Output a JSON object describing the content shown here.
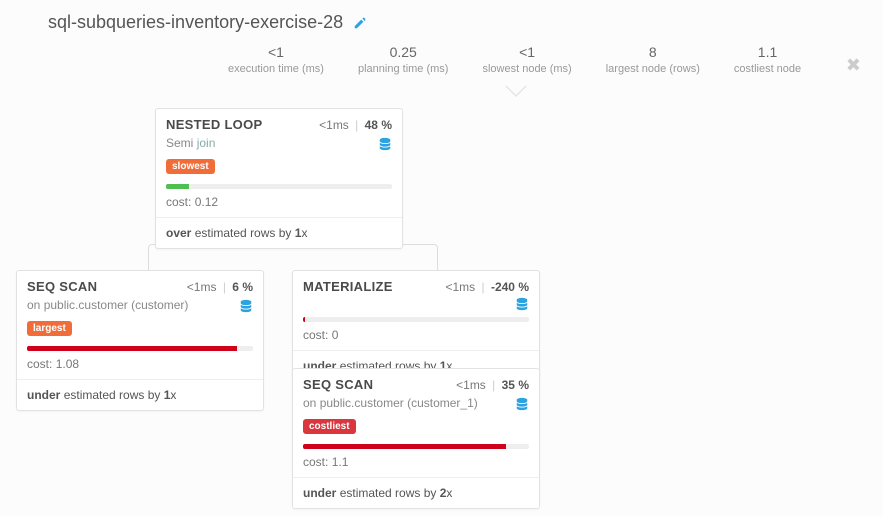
{
  "page": {
    "title": "sql-subqueries-inventory-exercise-28"
  },
  "stats": {
    "exec_val": "<1",
    "exec_lab": "execution time (ms)",
    "plan_val": "0.25",
    "plan_lab": "planning time (ms)",
    "slow_val": "<1",
    "slow_lab": "slowest node (ms)",
    "large_val": "8",
    "large_lab": "largest node (rows)",
    "cost_val": "1.1",
    "cost_lab": "costliest node"
  },
  "nodes": {
    "n1": {
      "title": "NESTED LOOP",
      "time_prefix": "<1",
      "time_unit": "ms",
      "pct": "48",
      "sub_prefix": "Semi",
      "sub_join": "join",
      "tag": "slowest",
      "bar_color": "green",
      "bar_pct": 10,
      "cost_label": "cost:",
      "cost_val": "0.12",
      "est_kw": "over",
      "est_mid": "estimated rows by",
      "est_x": "1",
      "est_suffix": "x"
    },
    "n2": {
      "title": "SEQ SCAN",
      "time_prefix": "<1",
      "time_unit": "ms",
      "pct": "6",
      "on_prefix": "on",
      "on_target": "public.customer (customer)",
      "tag": "largest",
      "bar_color": "red",
      "bar_pct": 93,
      "cost_label": "cost:",
      "cost_val": "1.08",
      "est_kw": "under",
      "est_mid": "estimated rows by",
      "est_x": "1",
      "est_suffix": "x"
    },
    "n3": {
      "title": "MATERIALIZE",
      "time_prefix": "<1",
      "time_unit": "ms",
      "pct": "-240",
      "bar_color": "red",
      "bar_pct": 1,
      "cost_label": "cost:",
      "cost_val": "0",
      "est_kw": "under",
      "est_mid": "estimated rows by",
      "est_x": "1",
      "est_suffix": "x"
    },
    "n4": {
      "title": "SEQ SCAN",
      "time_prefix": "<1",
      "time_unit": "ms",
      "pct": "35",
      "on_prefix": "on",
      "on_target": "public.customer (customer_1)",
      "tag": "costliest",
      "bar_color": "red",
      "bar_pct": 90,
      "cost_label": "cost:",
      "cost_val": "1.1",
      "est_kw": "under",
      "est_mid": "estimated rows by",
      "est_x": "2",
      "est_suffix": "x"
    }
  }
}
